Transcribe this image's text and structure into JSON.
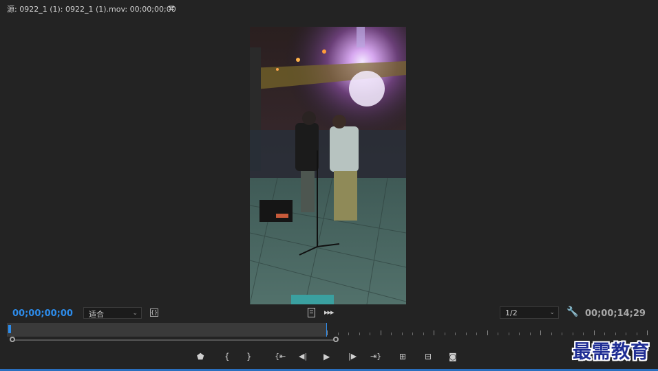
{
  "panel": {
    "title": "源: 0922_1 (1): 0922_1 (1).mov: 00;00;00;00",
    "menu_icon": "hamburger-icon"
  },
  "monitor": {
    "content": "video-frame",
    "accent_color": "#2d8ceb"
  },
  "controls": {
    "current_timecode": "00;00;00;00",
    "zoom_value": "适合",
    "resolution_value": "1/2",
    "duration_timecode": "00;00;14;29"
  },
  "transport": {
    "buttons": [
      {
        "name": "add-marker-icon",
        "glyph": "⬟"
      },
      {
        "name": "mark-in-icon",
        "glyph": "{"
      },
      {
        "name": "mark-out-icon",
        "glyph": "}"
      },
      {
        "name": "go-to-in-icon",
        "glyph": "{⇤"
      },
      {
        "name": "step-back-icon",
        "glyph": "◀|"
      },
      {
        "name": "play-icon",
        "glyph": "▶"
      },
      {
        "name": "step-forward-icon",
        "glyph": "|▶"
      },
      {
        "name": "go-to-out-icon",
        "glyph": "⇥}"
      },
      {
        "name": "insert-icon",
        "glyph": "⊞"
      },
      {
        "name": "overwrite-icon",
        "glyph": "⊟"
      },
      {
        "name": "export-frame-icon",
        "glyph": "📷"
      }
    ]
  },
  "watermark": {
    "text": "最需教育"
  }
}
